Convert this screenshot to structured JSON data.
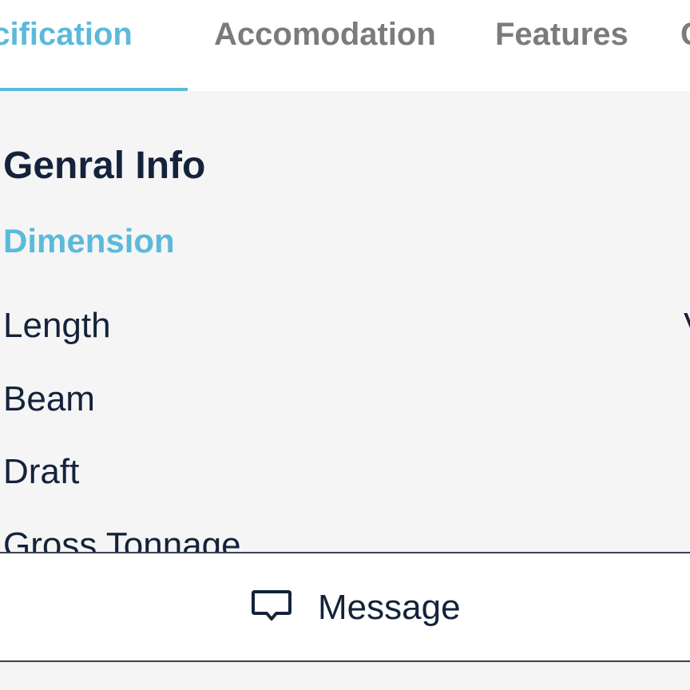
{
  "tabs": [
    {
      "label": "ecification",
      "active": true
    },
    {
      "label": "Accomodation",
      "active": false
    },
    {
      "label": "Features",
      "active": false
    },
    {
      "label": "C",
      "active": false
    }
  ],
  "content": {
    "section_title": "Genral Info",
    "subsection_title": "Dimension",
    "rows": [
      {
        "label": "Length",
        "value_fragment": "V"
      },
      {
        "label": "Beam"
      },
      {
        "label": "Draft"
      },
      {
        "label": "Gross Tonnage"
      }
    ]
  },
  "bottom_bar": {
    "message_label": "Message",
    "message_icon": "chat-bubble-icon"
  },
  "colors": {
    "accent": "#5bbad9",
    "text_dark": "#14233b",
    "tab_inactive": "#7b7b7b",
    "background": "#f5f5f5"
  }
}
